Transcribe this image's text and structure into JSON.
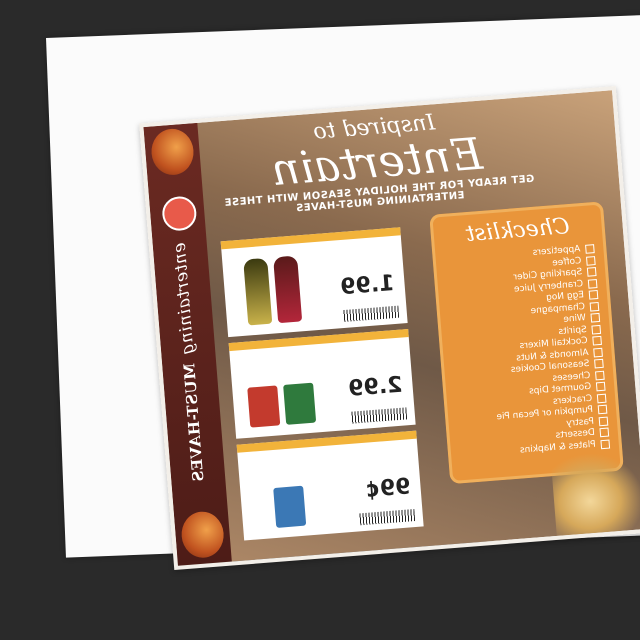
{
  "flyer": {
    "header_small": "Inspired to",
    "header_big": "Entertain",
    "header_sub": "GET READY FOR THE HOLIDAY SEASON WITH THESE ENTERTAINING MUST-HAVES",
    "spine_script": "entertaining",
    "spine_text": "MUST-HAVES",
    "checklist_title": "Checklist",
    "checklist_items": [
      "Appetizers",
      "Coffee",
      "Sparkling Cider",
      "Cranberry Juice",
      "Egg Nog",
      "Champagne",
      "Wine",
      "Spirits",
      "Cocktail Mixers",
      "Almonds & Nuts",
      "Seasonal Cookies",
      "Cheeses",
      "Gourmet Dips",
      "Crackers",
      "Pumpkin or Pecan Pie",
      "Pastry",
      "Desserts",
      "Plates & Napkins"
    ],
    "offers": [
      {
        "price": "1.99"
      },
      {
        "price": "2.99"
      },
      {
        "price": "99¢"
      }
    ],
    "colors": {
      "spine": "#5a2019",
      "checklist": "#e9953a",
      "offer_band": "#f2b33a"
    }
  }
}
